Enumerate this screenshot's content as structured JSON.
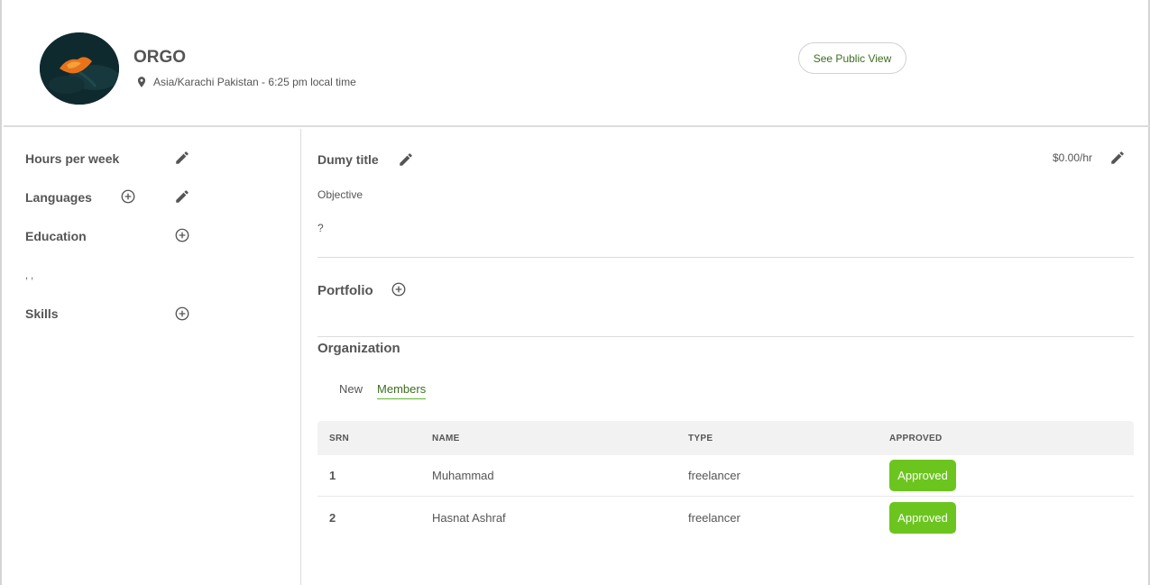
{
  "header": {
    "org_name": "ORGO",
    "location": "Asia/Karachi Pakistan - 6:25 pm local time",
    "public_view_label": "See Public View"
  },
  "sidebar": {
    "hours_label": "Hours per week",
    "languages_label": "Languages",
    "education_label": "Education",
    "education_note": ", ,",
    "skills_label": "Skills"
  },
  "profile": {
    "title": "Dumy title",
    "rate": "$0.00/hr",
    "objective": "Objective",
    "description": "?"
  },
  "portfolio": {
    "label": "Portfolio"
  },
  "organization": {
    "label": "Organization",
    "tabs": [
      "New",
      "Members"
    ],
    "active_tab": "Members",
    "columns": [
      "SRN",
      "NAME",
      "TYPE",
      "APPROVED"
    ],
    "rows": [
      {
        "srn": "1",
        "name": "Muhammad",
        "type": "freelancer",
        "approved": "Approved"
      },
      {
        "srn": "2",
        "name": "Hasnat Ashraf",
        "type": "freelancer",
        "approved": "Approved"
      }
    ]
  },
  "icons": {
    "edit": "pencil-icon",
    "add": "plus-circle-icon",
    "location": "map-pin-icon"
  },
  "colors": {
    "accent_green": "#6cc51f",
    "link_green": "#3d6e1f",
    "text": "#555555"
  }
}
